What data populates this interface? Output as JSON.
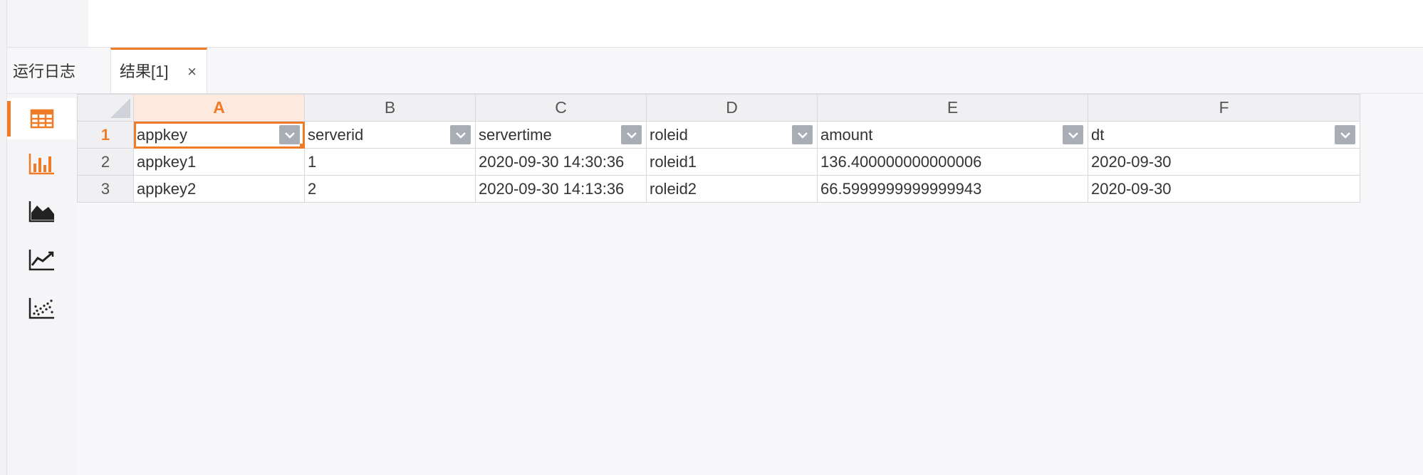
{
  "tabs": {
    "log_label": "运行日志",
    "result_label": "结果[1]",
    "close_glyph": "×"
  },
  "sidebar": {
    "items": [
      {
        "icon": "table-icon",
        "active": true
      },
      {
        "icon": "bar-chart-icon",
        "active": false
      },
      {
        "icon": "area-chart-icon",
        "active": false
      },
      {
        "icon": "line-chart-icon",
        "active": false
      },
      {
        "icon": "scatter-chart-icon",
        "active": false
      }
    ]
  },
  "sheet": {
    "columns": [
      "A",
      "B",
      "C",
      "D",
      "E",
      "F"
    ],
    "row_numbers": [
      "1",
      "2",
      "3"
    ],
    "header": [
      "appkey",
      "serverid",
      "servertime",
      "roleid",
      "amount",
      "dt"
    ],
    "rows": [
      [
        "appkey1",
        "1",
        "2020-09-30 14:30:36",
        "roleid1",
        "136.400000000000006",
        "2020-09-30"
      ],
      [
        "appkey2",
        "2",
        "2020-09-30 14:13:36",
        "roleid2",
        "66.5999999999999943",
        "2020-09-30"
      ]
    ]
  },
  "colors": {
    "accent": "#f07b26",
    "dropdown": "#a9adb6"
  }
}
